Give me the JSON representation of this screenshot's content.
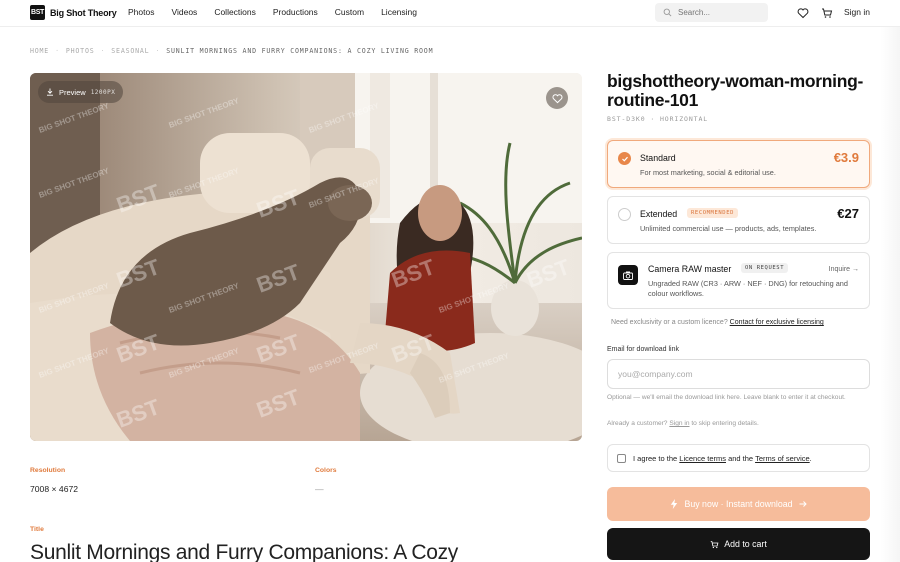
{
  "brand": {
    "mark": "BST",
    "name": "Big Shot Theory"
  },
  "nav": [
    "Photos",
    "Videos",
    "Collections",
    "Productions",
    "Custom",
    "Licensing"
  ],
  "search": {
    "placeholder": "Search..."
  },
  "header": {
    "signin": "Sign in"
  },
  "breadcrumb": [
    "HOME",
    "PHOTOS",
    "SEASONAL",
    "SUNLIT MORNINGS AND FURRY COMPANIONS: A COZY LIVING ROOM"
  ],
  "photo": {
    "preview_label": "Preview",
    "preview_res": "1200PX",
    "watermark": "BST",
    "watermark_small": "BIG SHOT THEORY"
  },
  "meta": {
    "resolution_label": "Resolution",
    "resolution_value": "7008 × 4672",
    "colors_label": "Colors",
    "colors_value": "—",
    "title_label": "Title",
    "title_value": "Sunlit Mornings and Furry Companions: A Cozy"
  },
  "product": {
    "title": "bigshottheory-woman-morning-routine-101",
    "id": "BST-D3K0",
    "orientation": "HORIZONTAL"
  },
  "licenses": [
    {
      "name": "Standard",
      "desc": "For most marketing, social & editorial use.",
      "price": "€3.9",
      "selected": true
    },
    {
      "name": "Extended",
      "badge": "RECOMMENDED",
      "desc": "Unlimited commercial use — products, ads, templates.",
      "price": "€27",
      "selected": false
    },
    {
      "name": "Camera RAW master",
      "badge": "ON REQUEST",
      "desc": "Ungraded RAW (CR3 · ARW · NEF · DNG) for retouching and colour workflows.",
      "action": "Inquire →"
    }
  ],
  "exclusive": {
    "text": "Need exclusivity or a custom licence?",
    "link": "Contact for exclusive licensing"
  },
  "email": {
    "label": "Email for download link",
    "placeholder": "you@company.com",
    "hint": "Optional — we'll email the download link here. Leave blank to enter it at checkout.",
    "customer_prefix": "Already a customer?",
    "customer_link": "Sign in",
    "customer_suffix": "to skip entering details."
  },
  "agree": {
    "prefix": "I agree to the",
    "terms": "Licence terms",
    "and": "and the",
    "tos": "Terms of service",
    "end": "."
  },
  "buttons": {
    "buy": "Buy now · Instant download",
    "cart": "Add to cart"
  },
  "colors": {
    "accent": "#e8874a",
    "accent_light": "#f6bc9b",
    "dark": "#151515"
  }
}
